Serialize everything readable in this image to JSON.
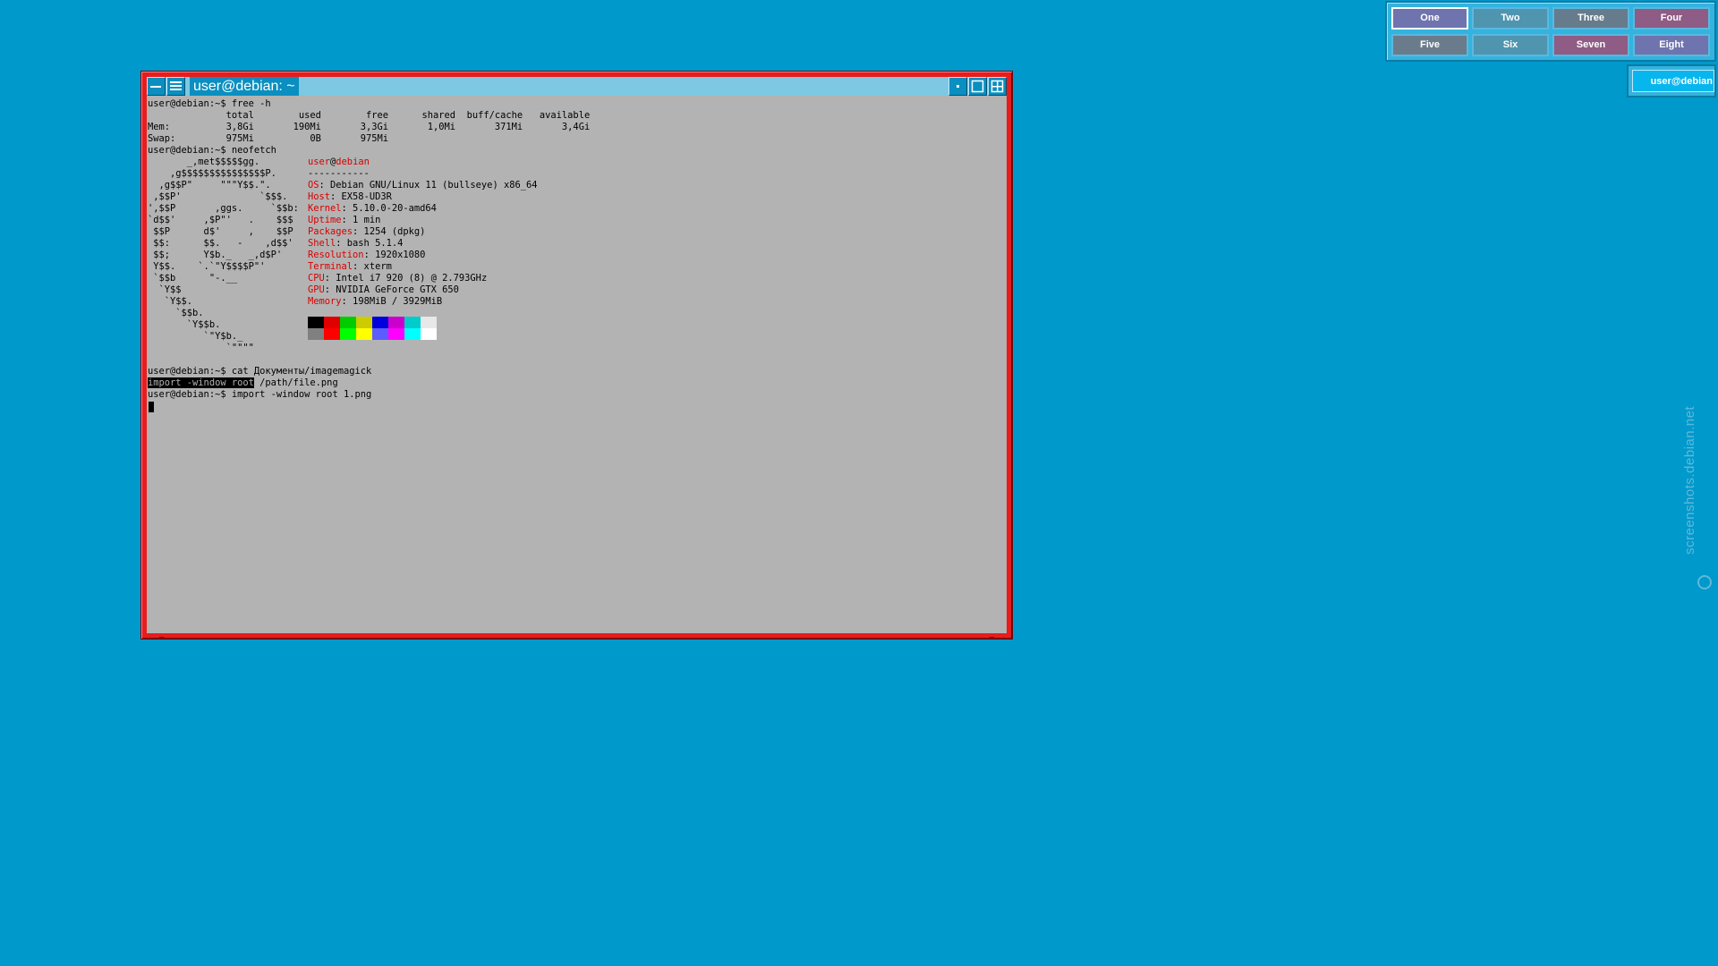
{
  "window": {
    "title": "user@debian: ~",
    "frame_color": "#e81c1c",
    "title_bg": "#0a8fc0",
    "terminal_bg": "#b3b3b3"
  },
  "terminal": {
    "line_free_cmd": "user@debian:~$ free -h",
    "line_free_header": "              total        used        free      shared  buff/cache   available",
    "line_mem": "Mem:          3,8Gi       190Mi       3,3Gi       1,0Mi       371Mi       3,4Gi",
    "line_swap": "Swap:         975Mi          0B       975Mi",
    "line_neofetch_cmd": "user@debian:~$ neofetch",
    "logo": [
      "       _,met$$$$$gg.",
      "    ,g$$$$$$$$$$$$$$$P.",
      "  ,g$$P\"     \"\"\"Y$$.\".",
      " ,$$P'              `$$$.",
      "',$$P       ,ggs.     `$$b:",
      "`d$$'     ,$P\"'   .    $$$",
      " $$P      d$'     ,    $$P",
      " $$:      $$.   -    ,d$$'",
      " $$;      Y$b._   _,d$P'",
      " Y$$.    `.`\"Y$$$$P\"'",
      " `$$b      \"-.__",
      "  `Y$$",
      "   `Y$$.",
      "     `$$b.",
      "       `Y$$b.",
      "          `\"Y$b._",
      "              `\"\"\"\""
    ],
    "info": {
      "user": "user",
      "at": "@",
      "host": "debian",
      "separator": "-----------",
      "rows": [
        {
          "key": "OS",
          "value": ": Debian GNU/Linux 11 (bullseye) x86_64"
        },
        {
          "key": "Host",
          "value": ": EX58-UD3R"
        },
        {
          "key": "Kernel",
          "value": ": 5.10.0-20-amd64"
        },
        {
          "key": "Uptime",
          "value": ": 1 min"
        },
        {
          "key": "Packages",
          "value": ": 1254 (dpkg)"
        },
        {
          "key": "Shell",
          "value": ": bash 5.1.4"
        },
        {
          "key": "Resolution",
          "value": ": 1920x1080"
        },
        {
          "key": "Terminal",
          "value": ": xterm"
        },
        {
          "key": "CPU",
          "value": ": Intel i7 920 (8) @ 2.793GHz"
        },
        {
          "key": "GPU",
          "value": ": NVIDIA GeForce GTX 650"
        },
        {
          "key": "Memory",
          "value": ": 198MiB / 3929MiB"
        }
      ]
    },
    "color_blocks": {
      "top": [
        "#000000",
        "#e00000",
        "#00cc00",
        "#cccc00",
        "#0000dd",
        "#cc00cc",
        "#00cccc",
        "#e8e8e8"
      ],
      "bottom": [
        "#808080",
        "#ff0000",
        "#00ff00",
        "#ffff00",
        "#5c5cff",
        "#ff00ff",
        "#00ffff",
        "#ffffff"
      ]
    },
    "line_cat_cmd": "user@debian:~$ cat Документы/imagemagick",
    "line_import_hl": "import -window root",
    "line_import_rest": " /path/file.png",
    "line_import_cmd": "user@debian:~$ import -window root 1.png"
  },
  "pager": {
    "desktops": [
      {
        "label": "One",
        "color": "#6f74ae",
        "active": true
      },
      {
        "label": "Two",
        "color": "#4f95b0",
        "active": false
      },
      {
        "label": "Three",
        "color": "#667c8c",
        "active": false
      },
      {
        "label": "Four",
        "color": "#8e5c84",
        "active": false
      },
      {
        "label": "Five",
        "color": "#6a7c8c",
        "active": false
      },
      {
        "label": "Six",
        "color": "#4f95b0",
        "active": false
      },
      {
        "label": "Seven",
        "color": "#8e5c84",
        "active": false
      },
      {
        "label": "Eight",
        "color": "#6f74ae",
        "active": false
      }
    ]
  },
  "iconbox": {
    "entry": "user@debian"
  },
  "watermark": {
    "text": "screenshots.debian.net"
  }
}
